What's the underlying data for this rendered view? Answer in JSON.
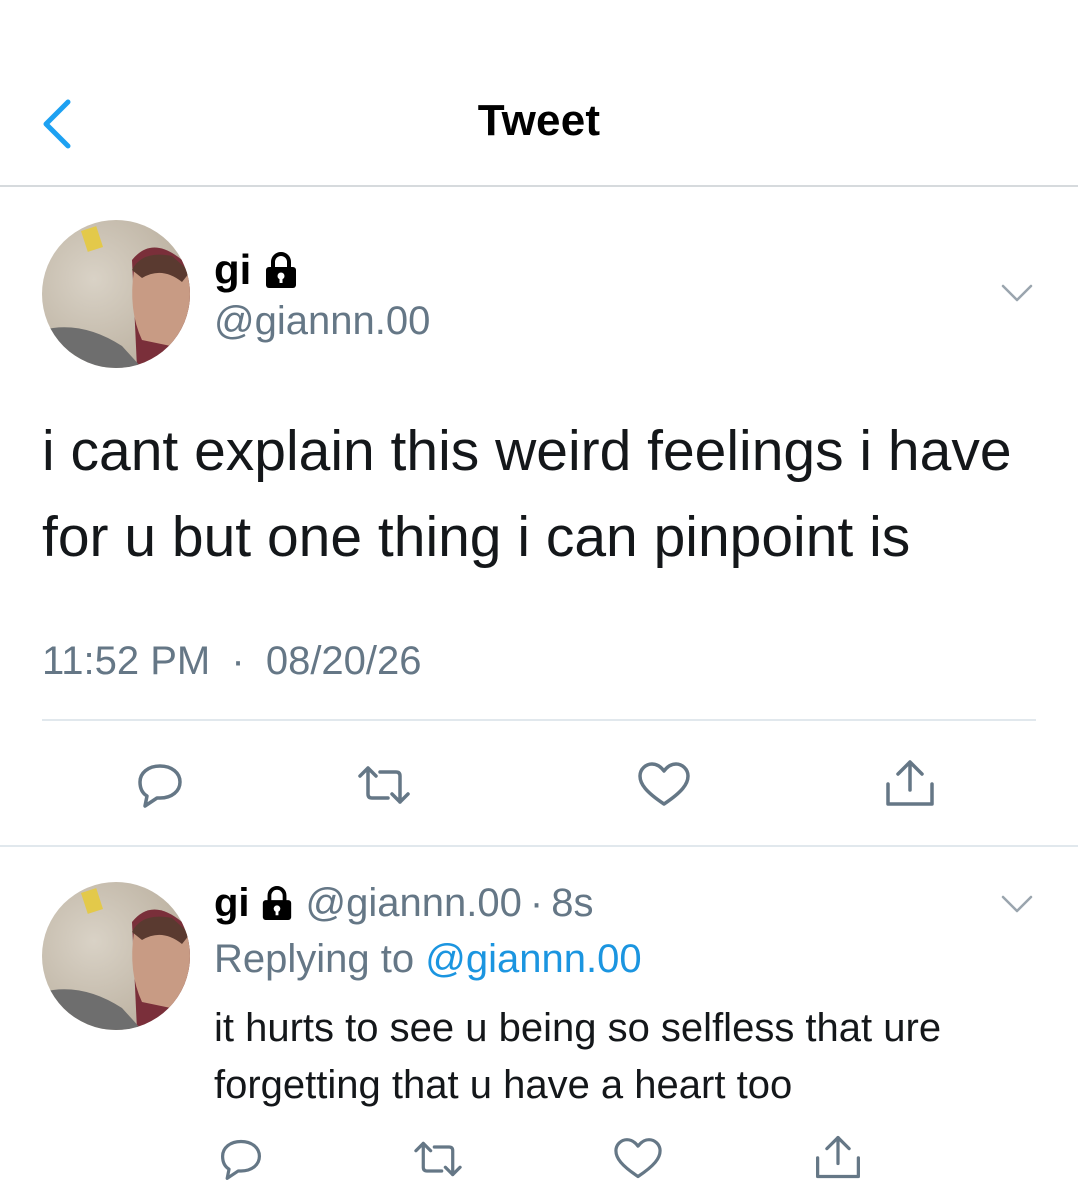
{
  "header": {
    "title": "Tweet",
    "back_icon": "chevron-left-icon",
    "accent_color": "#1da1f2"
  },
  "main_tweet": {
    "display_name": "gi",
    "protected_icon": "lock-icon",
    "handle": "@giannn.00",
    "text": "i cant explain this weird feelings i have for u but one thing i can pinpoint is",
    "time": "11:52 PM",
    "separator": "·",
    "date": "08/20/26",
    "actions": [
      "reply-icon",
      "retweet-icon",
      "like-icon",
      "share-icon"
    ]
  },
  "reply_tweet": {
    "display_name": "gi",
    "protected_icon": "lock-icon",
    "handle": "@giannn.00",
    "separator": "·",
    "time_ago": "8s",
    "replying_prefix": "Replying to",
    "replying_to": "@giannn.00",
    "text": "it hurts to see u being so selfless that ure forgetting that u have a heart too",
    "actions": [
      "reply-icon",
      "retweet-icon",
      "like-icon",
      "share-icon"
    ]
  },
  "colors": {
    "text_primary": "#14171a",
    "text_secondary": "#657786",
    "link": "#1b95e0",
    "icon_gray": "#657786",
    "divider": "#e1e8ed"
  }
}
